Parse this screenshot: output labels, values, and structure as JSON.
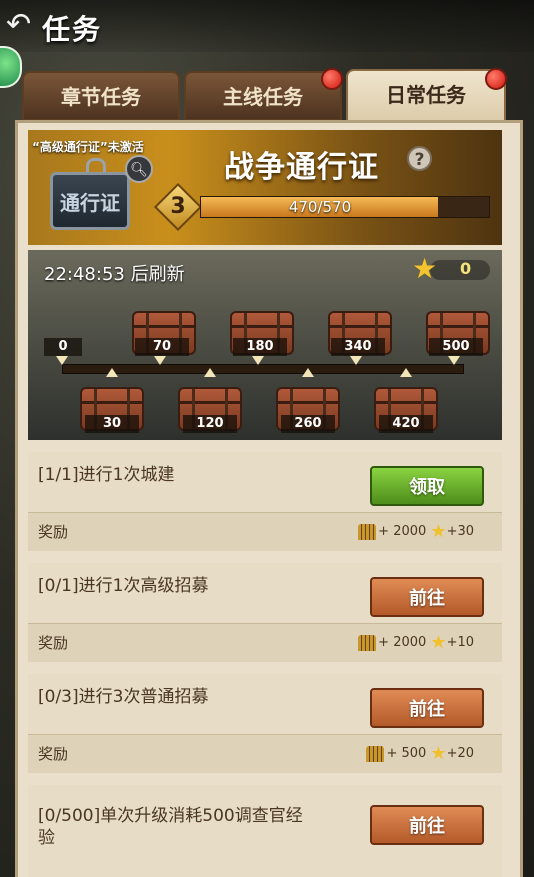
{
  "header": {
    "title": "任务",
    "back_icon": "back-arrow-icon"
  },
  "tabs": [
    {
      "label": "章节任务",
      "badge": false,
      "active": false
    },
    {
      "label": "主线任务",
      "badge": true,
      "active": false
    },
    {
      "label": "日常任务",
      "badge": true,
      "active": true
    }
  ],
  "pass": {
    "note": "“高级通行证”未激活",
    "card_label": "通行证",
    "title": "战争通行证",
    "help_label": "?",
    "level": "3",
    "progress_text": "470/570",
    "progress": 0.8246
  },
  "track": {
    "refresh_text": "22:48:53 后刷新",
    "star_count": "0",
    "start_label": "0",
    "top_chests": [
      "70",
      "180",
      "340",
      "500"
    ],
    "bottom_chests": [
      "30",
      "120",
      "260",
      "420"
    ]
  },
  "tasks": [
    {
      "desc": "[1/1]进行1次城建",
      "button": "领取",
      "button_style": "green",
      "reward_label": "奖励",
      "ammo": "+ 2000",
      "stars": "+30"
    },
    {
      "desc": "[0/1]进行1次高级招募",
      "button": "前往",
      "button_style": "orange",
      "reward_label": "奖励",
      "ammo": "+ 2000",
      "stars": "+10"
    },
    {
      "desc": "[0/3]进行3次普通招募",
      "button": "前往",
      "button_style": "orange",
      "reward_label": "奖励",
      "ammo": "+ 500",
      "stars": "+20"
    },
    {
      "desc": "[0/500]单次升级消耗500调查官经验",
      "button": "前往",
      "button_style": "orange",
      "reward_label": "",
      "ammo": "",
      "stars": ""
    }
  ],
  "colors": {
    "accent_gold": "#c98f1c",
    "button_green": "#6bb22c",
    "button_orange": "#c9713f"
  }
}
